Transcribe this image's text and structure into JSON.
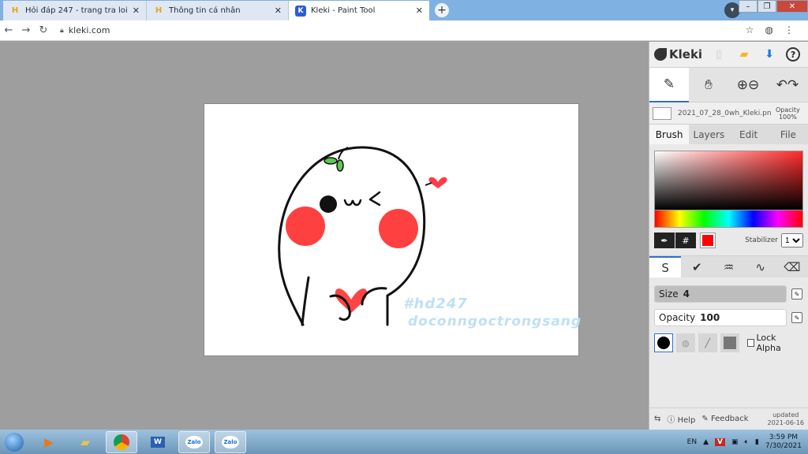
{
  "browser": {
    "tabs": [
      {
        "label": "Hỏi đáp 247 - trang tra loi",
        "active": false
      },
      {
        "label": "Thông tin cá nhân",
        "active": false
      },
      {
        "label": "Kleki - Paint Tool",
        "active": true
      }
    ],
    "new_tab": "+",
    "url": "kleki.com"
  },
  "canvas": {
    "watermark_line1": "#hd247",
    "watermark_line2": "doconngoctrongsang"
  },
  "panel": {
    "logo_text": "Kleki",
    "file_name": "2021_07_28_0wh_Kleki.png",
    "opacity_label": "Opacity",
    "opacity_value": "100%",
    "tabs": [
      "Brush",
      "Layers",
      "Edit",
      "File"
    ],
    "hash_label": "#",
    "stabilizer_label": "Stabilizer",
    "stabilizer_value": "1",
    "size_label": "Size",
    "size_value": "4",
    "opacity_slider_label": "Opacity",
    "opacity_slider_value": "100",
    "lock_alpha_label": "Lock Alpha",
    "help_label": "Help",
    "feedback_label": "Feedback",
    "updated_label": "updated",
    "updated_date": "2021-06-16",
    "brush_color": "#ff0000"
  },
  "taskbar": {
    "language": "EN",
    "time": "3:59 PM",
    "date": "7/30/2021",
    "zalo1": "Zalo",
    "zalo2": "Zalo"
  }
}
